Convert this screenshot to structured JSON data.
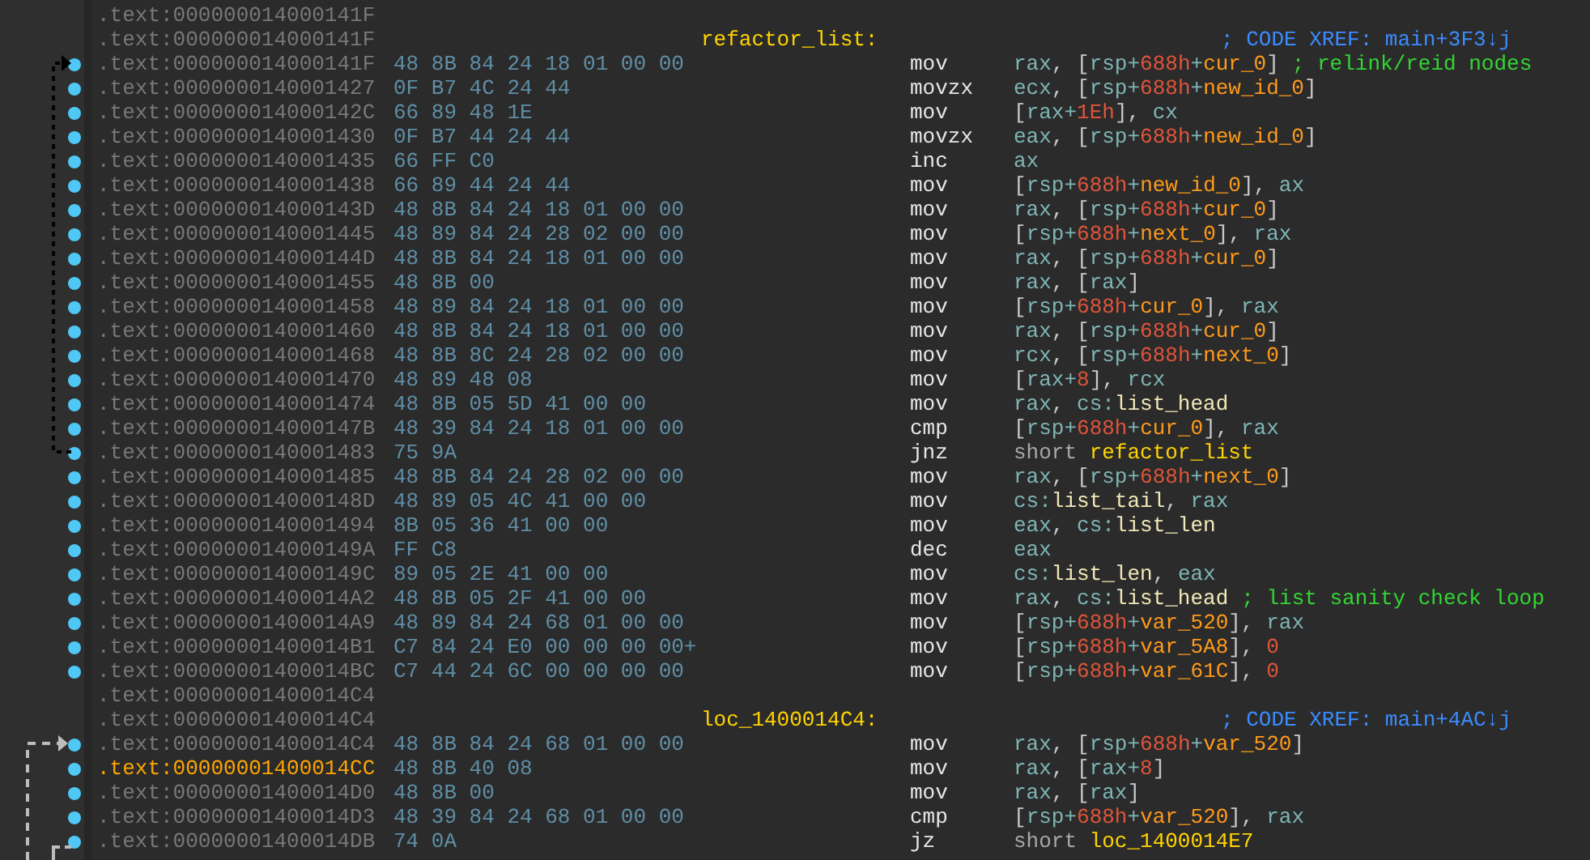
{
  "listing": [
    {
      "address": ".text:000000014000141F",
      "dot": false,
      "current": false
    },
    {
      "address": ".text:000000014000141F",
      "label": "refactor_list:",
      "xref": "; CODE XREF: main+3F3↓j",
      "dot": false,
      "current": false
    },
    {
      "address": ".text:000000014000141F",
      "bytes": "48 8B 84 24 18 01 00 00",
      "mnemonic": "mov",
      "operands": [
        {
          "text": "rax",
          "kind": "reg"
        },
        {
          "text": ", ",
          "kind": "punct"
        },
        {
          "text": "[",
          "kind": "punct"
        },
        {
          "text": "rsp",
          "kind": "reg"
        },
        {
          "text": "+",
          "kind": "reg"
        },
        {
          "text": "688h",
          "kind": "num"
        },
        {
          "text": "+",
          "kind": "reg"
        },
        {
          "text": "cur_0",
          "kind": "var"
        },
        {
          "text": "]",
          "kind": "punct"
        }
      ],
      "comment": "; relink/reid nodes",
      "dot": true,
      "current": false
    },
    {
      "address": ".text:0000000140001427",
      "bytes": "0F B7 4C 24 44",
      "mnemonic": "movzx",
      "operands": [
        {
          "text": "ecx",
          "kind": "reg"
        },
        {
          "text": ", ",
          "kind": "punct"
        },
        {
          "text": "[",
          "kind": "punct"
        },
        {
          "text": "rsp",
          "kind": "reg"
        },
        {
          "text": "+",
          "kind": "reg"
        },
        {
          "text": "688h",
          "kind": "num"
        },
        {
          "text": "+",
          "kind": "reg"
        },
        {
          "text": "new_id_0",
          "kind": "var"
        },
        {
          "text": "]",
          "kind": "punct"
        }
      ],
      "dot": true,
      "current": false
    },
    {
      "address": ".text:000000014000142C",
      "bytes": "66 89 48 1E",
      "mnemonic": "mov",
      "operands": [
        {
          "text": "[",
          "kind": "punct"
        },
        {
          "text": "rax",
          "kind": "reg"
        },
        {
          "text": "+",
          "kind": "reg"
        },
        {
          "text": "1Eh",
          "kind": "num"
        },
        {
          "text": "]",
          "kind": "punct"
        },
        {
          "text": ", ",
          "kind": "punct"
        },
        {
          "text": "cx",
          "kind": "reg"
        }
      ],
      "dot": true,
      "current": false
    },
    {
      "address": ".text:0000000140001430",
      "bytes": "0F B7 44 24 44",
      "mnemonic": "movzx",
      "operands": [
        {
          "text": "eax",
          "kind": "reg"
        },
        {
          "text": ", ",
          "kind": "punct"
        },
        {
          "text": "[",
          "kind": "punct"
        },
        {
          "text": "rsp",
          "kind": "reg"
        },
        {
          "text": "+",
          "kind": "reg"
        },
        {
          "text": "688h",
          "kind": "num"
        },
        {
          "text": "+",
          "kind": "reg"
        },
        {
          "text": "new_id_0",
          "kind": "var"
        },
        {
          "text": "]",
          "kind": "punct"
        }
      ],
      "dot": true,
      "current": false
    },
    {
      "address": ".text:0000000140001435",
      "bytes": "66 FF C0",
      "mnemonic": "inc",
      "operands": [
        {
          "text": "ax",
          "kind": "reg"
        }
      ],
      "dot": true,
      "current": false
    },
    {
      "address": ".text:0000000140001438",
      "bytes": "66 89 44 24 44",
      "mnemonic": "mov",
      "operands": [
        {
          "text": "[",
          "kind": "punct"
        },
        {
          "text": "rsp",
          "kind": "reg"
        },
        {
          "text": "+",
          "kind": "reg"
        },
        {
          "text": "688h",
          "kind": "num"
        },
        {
          "text": "+",
          "kind": "reg"
        },
        {
          "text": "new_id_0",
          "kind": "var"
        },
        {
          "text": "]",
          "kind": "punct"
        },
        {
          "text": ", ",
          "kind": "punct"
        },
        {
          "text": "ax",
          "kind": "reg"
        }
      ],
      "dot": true,
      "current": false
    },
    {
      "address": ".text:000000014000143D",
      "bytes": "48 8B 84 24 18 01 00 00",
      "mnemonic": "mov",
      "operands": [
        {
          "text": "rax",
          "kind": "reg"
        },
        {
          "text": ", ",
          "kind": "punct"
        },
        {
          "text": "[",
          "kind": "punct"
        },
        {
          "text": "rsp",
          "kind": "reg"
        },
        {
          "text": "+",
          "kind": "reg"
        },
        {
          "text": "688h",
          "kind": "num"
        },
        {
          "text": "+",
          "kind": "reg"
        },
        {
          "text": "cur_0",
          "kind": "var"
        },
        {
          "text": "]",
          "kind": "punct"
        }
      ],
      "dot": true,
      "current": false
    },
    {
      "address": ".text:0000000140001445",
      "bytes": "48 89 84 24 28 02 00 00",
      "mnemonic": "mov",
      "operands": [
        {
          "text": "[",
          "kind": "punct"
        },
        {
          "text": "rsp",
          "kind": "reg"
        },
        {
          "text": "+",
          "kind": "reg"
        },
        {
          "text": "688h",
          "kind": "num"
        },
        {
          "text": "+",
          "kind": "reg"
        },
        {
          "text": "next_0",
          "kind": "var"
        },
        {
          "text": "]",
          "kind": "punct"
        },
        {
          "text": ", ",
          "kind": "punct"
        },
        {
          "text": "rax",
          "kind": "reg"
        }
      ],
      "dot": true,
      "current": false
    },
    {
      "address": ".text:000000014000144D",
      "bytes": "48 8B 84 24 18 01 00 00",
      "mnemonic": "mov",
      "operands": [
        {
          "text": "rax",
          "kind": "reg"
        },
        {
          "text": ", ",
          "kind": "punct"
        },
        {
          "text": "[",
          "kind": "punct"
        },
        {
          "text": "rsp",
          "kind": "reg"
        },
        {
          "text": "+",
          "kind": "reg"
        },
        {
          "text": "688h",
          "kind": "num"
        },
        {
          "text": "+",
          "kind": "reg"
        },
        {
          "text": "cur_0",
          "kind": "var"
        },
        {
          "text": "]",
          "kind": "punct"
        }
      ],
      "dot": true,
      "current": false
    },
    {
      "address": ".text:0000000140001455",
      "bytes": "48 8B 00",
      "mnemonic": "mov",
      "operands": [
        {
          "text": "rax",
          "kind": "reg"
        },
        {
          "text": ", ",
          "kind": "punct"
        },
        {
          "text": "[",
          "kind": "punct"
        },
        {
          "text": "rax",
          "kind": "reg"
        },
        {
          "text": "]",
          "kind": "punct"
        }
      ],
      "dot": true,
      "current": false
    },
    {
      "address": ".text:0000000140001458",
      "bytes": "48 89 84 24 18 01 00 00",
      "mnemonic": "mov",
      "operands": [
        {
          "text": "[",
          "kind": "punct"
        },
        {
          "text": "rsp",
          "kind": "reg"
        },
        {
          "text": "+",
          "kind": "reg"
        },
        {
          "text": "688h",
          "kind": "num"
        },
        {
          "text": "+",
          "kind": "reg"
        },
        {
          "text": "cur_0",
          "kind": "var"
        },
        {
          "text": "]",
          "kind": "punct"
        },
        {
          "text": ", ",
          "kind": "punct"
        },
        {
          "text": "rax",
          "kind": "reg"
        }
      ],
      "dot": true,
      "current": false
    },
    {
      "address": ".text:0000000140001460",
      "bytes": "48 8B 84 24 18 01 00 00",
      "mnemonic": "mov",
      "operands": [
        {
          "text": "rax",
          "kind": "reg"
        },
        {
          "text": ", ",
          "kind": "punct"
        },
        {
          "text": "[",
          "kind": "punct"
        },
        {
          "text": "rsp",
          "kind": "reg"
        },
        {
          "text": "+",
          "kind": "reg"
        },
        {
          "text": "688h",
          "kind": "num"
        },
        {
          "text": "+",
          "kind": "reg"
        },
        {
          "text": "cur_0",
          "kind": "var"
        },
        {
          "text": "]",
          "kind": "punct"
        }
      ],
      "dot": true,
      "current": false
    },
    {
      "address": ".text:0000000140001468",
      "bytes": "48 8B 8C 24 28 02 00 00",
      "mnemonic": "mov",
      "operands": [
        {
          "text": "rcx",
          "kind": "reg"
        },
        {
          "text": ", ",
          "kind": "punct"
        },
        {
          "text": "[",
          "kind": "punct"
        },
        {
          "text": "rsp",
          "kind": "reg"
        },
        {
          "text": "+",
          "kind": "reg"
        },
        {
          "text": "688h",
          "kind": "num"
        },
        {
          "text": "+",
          "kind": "reg"
        },
        {
          "text": "next_0",
          "kind": "var"
        },
        {
          "text": "]",
          "kind": "punct"
        }
      ],
      "dot": true,
      "current": false
    },
    {
      "address": ".text:0000000140001470",
      "bytes": "48 89 48 08",
      "mnemonic": "mov",
      "operands": [
        {
          "text": "[",
          "kind": "punct"
        },
        {
          "text": "rax",
          "kind": "reg"
        },
        {
          "text": "+",
          "kind": "reg"
        },
        {
          "text": "8",
          "kind": "num"
        },
        {
          "text": "]",
          "kind": "punct"
        },
        {
          "text": ", ",
          "kind": "punct"
        },
        {
          "text": "rcx",
          "kind": "reg"
        }
      ],
      "dot": true,
      "current": false
    },
    {
      "address": ".text:0000000140001474",
      "bytes": "48 8B 05 5D 41 00 00",
      "mnemonic": "mov",
      "operands": [
        {
          "text": "rax",
          "kind": "reg"
        },
        {
          "text": ", ",
          "kind": "punct"
        },
        {
          "text": "cs:",
          "kind": "reg"
        },
        {
          "text": "list_head",
          "kind": "sym"
        }
      ],
      "dot": true,
      "current": false
    },
    {
      "address": ".text:000000014000147B",
      "bytes": "48 39 84 24 18 01 00 00",
      "mnemonic": "cmp",
      "operands": [
        {
          "text": "[",
          "kind": "punct"
        },
        {
          "text": "rsp",
          "kind": "reg"
        },
        {
          "text": "+",
          "kind": "reg"
        },
        {
          "text": "688h",
          "kind": "num"
        },
        {
          "text": "+",
          "kind": "reg"
        },
        {
          "text": "cur_0",
          "kind": "var"
        },
        {
          "text": "]",
          "kind": "punct"
        },
        {
          "text": ", ",
          "kind": "punct"
        },
        {
          "text": "rax",
          "kind": "reg"
        }
      ],
      "dot": true,
      "current": false
    },
    {
      "address": ".text:0000000140001483",
      "bytes": "75 9A",
      "mnemonic": "jnz",
      "operands": [
        {
          "text": "short ",
          "kind": "keyword"
        },
        {
          "text": "refactor_list",
          "kind": "label"
        }
      ],
      "dot": true,
      "current": false
    },
    {
      "address": ".text:0000000140001485",
      "bytes": "48 8B 84 24 28 02 00 00",
      "mnemonic": "mov",
      "operands": [
        {
          "text": "rax",
          "kind": "reg"
        },
        {
          "text": ", ",
          "kind": "punct"
        },
        {
          "text": "[",
          "kind": "punct"
        },
        {
          "text": "rsp",
          "kind": "reg"
        },
        {
          "text": "+",
          "kind": "reg"
        },
        {
          "text": "688h",
          "kind": "num"
        },
        {
          "text": "+",
          "kind": "reg"
        },
        {
          "text": "next_0",
          "kind": "var"
        },
        {
          "text": "]",
          "kind": "punct"
        }
      ],
      "dot": true,
      "current": false
    },
    {
      "address": ".text:000000014000148D",
      "bytes": "48 89 05 4C 41 00 00",
      "mnemonic": "mov",
      "operands": [
        {
          "text": "cs:",
          "kind": "reg"
        },
        {
          "text": "list_tail",
          "kind": "sym"
        },
        {
          "text": ", ",
          "kind": "punct"
        },
        {
          "text": "rax",
          "kind": "reg"
        }
      ],
      "dot": true,
      "current": false
    },
    {
      "address": ".text:0000000140001494",
      "bytes": "8B 05 36 41 00 00",
      "mnemonic": "mov",
      "operands": [
        {
          "text": "eax",
          "kind": "reg"
        },
        {
          "text": ", ",
          "kind": "punct"
        },
        {
          "text": "cs:",
          "kind": "reg"
        },
        {
          "text": "list_len",
          "kind": "sym"
        }
      ],
      "dot": true,
      "current": false
    },
    {
      "address": ".text:000000014000149A",
      "bytes": "FF C8",
      "mnemonic": "dec",
      "operands": [
        {
          "text": "eax",
          "kind": "reg"
        }
      ],
      "dot": true,
      "current": false
    },
    {
      "address": ".text:000000014000149C",
      "bytes": "89 05 2E 41 00 00",
      "mnemonic": "mov",
      "operands": [
        {
          "text": "cs:",
          "kind": "reg"
        },
        {
          "text": "list_len",
          "kind": "sym"
        },
        {
          "text": ", ",
          "kind": "punct"
        },
        {
          "text": "eax",
          "kind": "reg"
        }
      ],
      "dot": true,
      "current": false
    },
    {
      "address": ".text:00000001400014A2",
      "bytes": "48 8B 05 2F 41 00 00",
      "mnemonic": "mov",
      "operands": [
        {
          "text": "rax",
          "kind": "reg"
        },
        {
          "text": ", ",
          "kind": "punct"
        },
        {
          "text": "cs:",
          "kind": "reg"
        },
        {
          "text": "list_head",
          "kind": "sym"
        }
      ],
      "comment": "; list sanity check loop",
      "dot": true,
      "current": false
    },
    {
      "address": ".text:00000001400014A9",
      "bytes": "48 89 84 24 68 01 00 00",
      "mnemonic": "mov",
      "operands": [
        {
          "text": "[",
          "kind": "punct"
        },
        {
          "text": "rsp",
          "kind": "reg"
        },
        {
          "text": "+",
          "kind": "reg"
        },
        {
          "text": "688h",
          "kind": "num"
        },
        {
          "text": "+",
          "kind": "reg"
        },
        {
          "text": "var_520",
          "kind": "var"
        },
        {
          "text": "]",
          "kind": "punct"
        },
        {
          "text": ", ",
          "kind": "punct"
        },
        {
          "text": "rax",
          "kind": "reg"
        }
      ],
      "dot": true,
      "current": false
    },
    {
      "address": ".text:00000001400014B1",
      "bytes": "C7 84 24 E0 00 00 00 00+",
      "mnemonic": "mov",
      "operands": [
        {
          "text": "[",
          "kind": "punct"
        },
        {
          "text": "rsp",
          "kind": "reg"
        },
        {
          "text": "+",
          "kind": "reg"
        },
        {
          "text": "688h",
          "kind": "num"
        },
        {
          "text": "+",
          "kind": "reg"
        },
        {
          "text": "var_5A8",
          "kind": "var"
        },
        {
          "text": "]",
          "kind": "punct"
        },
        {
          "text": ", ",
          "kind": "punct"
        },
        {
          "text": "0",
          "kind": "num"
        }
      ],
      "dot": true,
      "current": false
    },
    {
      "address": ".text:00000001400014BC",
      "bytes": "C7 44 24 6C 00 00 00 00",
      "mnemonic": "mov",
      "operands": [
        {
          "text": "[",
          "kind": "punct"
        },
        {
          "text": "rsp",
          "kind": "reg"
        },
        {
          "text": "+",
          "kind": "reg"
        },
        {
          "text": "688h",
          "kind": "num"
        },
        {
          "text": "+",
          "kind": "reg"
        },
        {
          "text": "var_61C",
          "kind": "var"
        },
        {
          "text": "]",
          "kind": "punct"
        },
        {
          "text": ", ",
          "kind": "punct"
        },
        {
          "text": "0",
          "kind": "num"
        }
      ],
      "dot": true,
      "current": false
    },
    {
      "address": ".text:00000001400014C4",
      "dot": false,
      "current": false
    },
    {
      "address": ".text:00000001400014C4",
      "label": "loc_1400014C4:",
      "xref": "; CODE XREF: main+4AC↓j",
      "dot": false,
      "current": false
    },
    {
      "address": ".text:00000001400014C4",
      "bytes": "48 8B 84 24 68 01 00 00",
      "mnemonic": "mov",
      "operands": [
        {
          "text": "rax",
          "kind": "reg"
        },
        {
          "text": ", ",
          "kind": "punct"
        },
        {
          "text": "[",
          "kind": "punct"
        },
        {
          "text": "rsp",
          "kind": "reg"
        },
        {
          "text": "+",
          "kind": "reg"
        },
        {
          "text": "688h",
          "kind": "num"
        },
        {
          "text": "+",
          "kind": "reg"
        },
        {
          "text": "var_520",
          "kind": "var"
        },
        {
          "text": "]",
          "kind": "punct"
        }
      ],
      "dot": true,
      "current": false
    },
    {
      "address": ".text:00000001400014CC",
      "bytes": "48 8B 40 08",
      "mnemonic": "mov",
      "operands": [
        {
          "text": "rax",
          "kind": "reg"
        },
        {
          "text": ", ",
          "kind": "punct"
        },
        {
          "text": "[",
          "kind": "punct"
        },
        {
          "text": "rax",
          "kind": "reg"
        },
        {
          "text": "+",
          "kind": "reg"
        },
        {
          "text": "8",
          "kind": "num"
        },
        {
          "text": "]",
          "kind": "punct"
        }
      ],
      "dot": true,
      "current": true
    },
    {
      "address": ".text:00000001400014D0",
      "bytes": "48 8B 00",
      "mnemonic": "mov",
      "operands": [
        {
          "text": "rax",
          "kind": "reg"
        },
        {
          "text": ", ",
          "kind": "punct"
        },
        {
          "text": "[",
          "kind": "punct"
        },
        {
          "text": "rax",
          "kind": "reg"
        },
        {
          "text": "]",
          "kind": "punct"
        }
      ],
      "dot": true,
      "current": false
    },
    {
      "address": ".text:00000001400014D3",
      "bytes": "48 39 84 24 68 01 00 00",
      "mnemonic": "cmp",
      "operands": [
        {
          "text": "[",
          "kind": "punct"
        },
        {
          "text": "rsp",
          "kind": "reg"
        },
        {
          "text": "+",
          "kind": "reg"
        },
        {
          "text": "688h",
          "kind": "num"
        },
        {
          "text": "+",
          "kind": "reg"
        },
        {
          "text": "var_520",
          "kind": "var"
        },
        {
          "text": "]",
          "kind": "punct"
        },
        {
          "text": ", ",
          "kind": "punct"
        },
        {
          "text": "rax",
          "kind": "reg"
        }
      ],
      "dot": true,
      "current": false
    },
    {
      "address": ".text:00000001400014DB",
      "bytes": "74 0A",
      "mnemonic": "jz",
      "operands": [
        {
          "text": "short ",
          "kind": "keyword"
        },
        {
          "text": "loc_1400014E7",
          "kind": "label"
        }
      ],
      "dot": true,
      "current": false
    }
  ]
}
